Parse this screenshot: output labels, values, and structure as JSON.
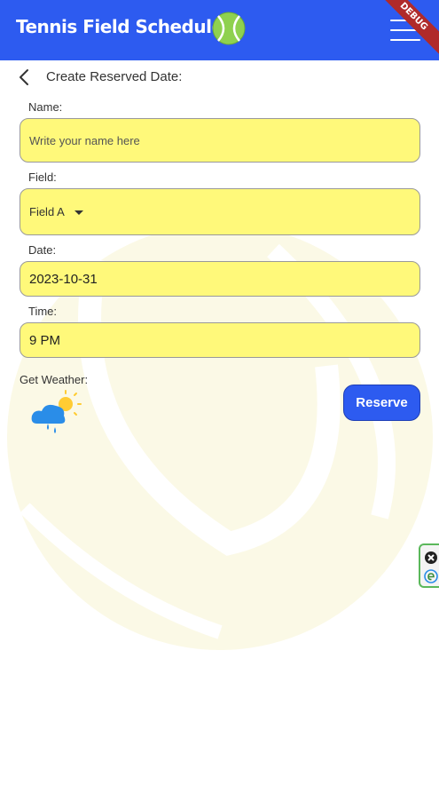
{
  "appbar": {
    "title": "Tennis Field Scheduler",
    "ball_icon": "tennis-ball-icon",
    "menu_icon": "hamburger-menu-icon",
    "debug_label": "DEBUG",
    "color": "#2d5bf0"
  },
  "page": {
    "back_icon": "chevron-left-icon",
    "title": "Create Reserved Date:"
  },
  "form": {
    "name_label": "Name:",
    "name_placeholder": "Write your name here",
    "name_value": "",
    "field_label": "Field:",
    "field_value": "Field A",
    "date_label": "Date:",
    "date_value": "2023-10-31",
    "time_label": "Time:",
    "time_value": "9 PM",
    "input_color": "#fff97a"
  },
  "weather": {
    "label": "Get Weather:",
    "icon": "rain-sun-cloud-icon"
  },
  "actions": {
    "reserve_label": "Reserve"
  }
}
